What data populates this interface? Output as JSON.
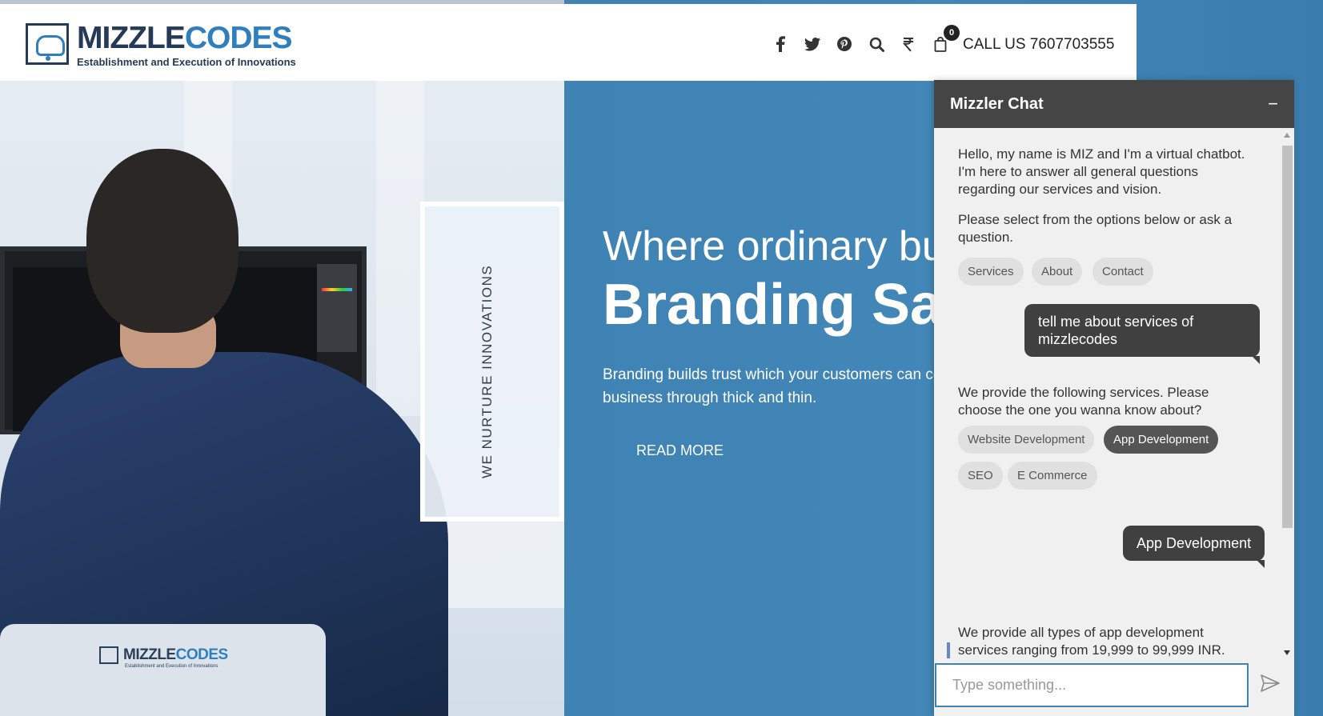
{
  "brand": {
    "name_part1": "MIZZLE",
    "name_part2": "CODES",
    "tagline": "Establishment and Execution of Innovations"
  },
  "header": {
    "icons": [
      "facebook-icon",
      "twitter-icon",
      "pinterest-icon",
      "search-icon",
      "rupee-icon",
      "cart-icon"
    ],
    "cart_count": "0",
    "call_us": "CALL US 7607703555"
  },
  "hero": {
    "vertical_text": "WE NURTURE INNOVATIONS",
    "title_line1": "Where ordinary bu",
    "title_line2": "Branding Sa",
    "description": "Branding builds trust which your customers can co your business through thick and thin.",
    "read_more": "READ MORE"
  },
  "chat": {
    "title": "Mizzler Chat",
    "minimize": "−",
    "messages": {
      "greeting": "Hello, my name is MIZ and I'm a virtual chatbot. I'm here to answer all general questions regarding our services and vision.",
      "prompt": "Please select from the options below or ask a question.",
      "user_1": "tell me about services of mizzlecodes",
      "services_intro": "We provide the following services. Please choose the one you wanna know about?",
      "user_2": "App Development",
      "app_dev_reply": "We provide all types of app development services ranging from 19,999 to 99,999 INR."
    },
    "quick_options": [
      "Services",
      "About",
      "Contact"
    ],
    "service_options": [
      "Website Development",
      "App Development",
      "SEO",
      "E Commerce"
    ],
    "active_option": "App Development",
    "input_placeholder": "Type something..."
  },
  "colors": {
    "accent_blue": "#3f82b4",
    "chat_header": "#454545",
    "user_bubble": "#404040",
    "brand_dark": "#243a56"
  }
}
